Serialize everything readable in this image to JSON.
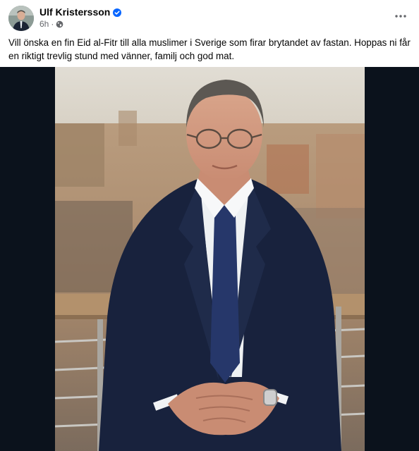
{
  "post": {
    "author": "Ulf Kristersson",
    "time": "6h",
    "separator": "·",
    "text": "Vill önska en fin Eid al-Fitr till alla muslimer i Sverige som firar brytandet av fastan. Hoppas ni får en riktigt trevlig stund med vänner, familj och god mat."
  },
  "icons": {
    "verified": "verified-badge-icon",
    "audience": "globe-icon",
    "more": "more-horizontal-icon"
  },
  "colors": {
    "verified": "#0866ff",
    "secondary_text": "#65676b",
    "media_background": "#0b121c"
  }
}
